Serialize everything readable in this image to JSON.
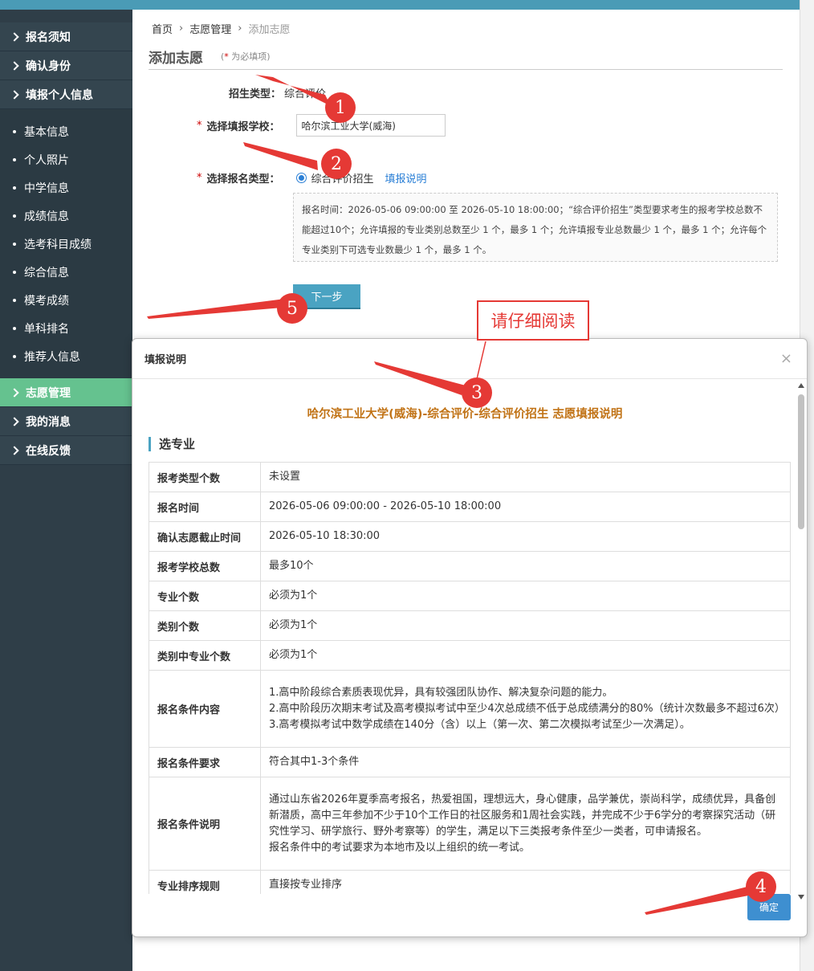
{
  "sidebar": {
    "top_items": [
      {
        "label": "报名须知"
      },
      {
        "label": "确认身份"
      },
      {
        "label": "填报个人信息"
      }
    ],
    "sub_items": [
      {
        "label": "基本信息"
      },
      {
        "label": "个人照片"
      },
      {
        "label": "中学信息"
      },
      {
        "label": "成绩信息"
      },
      {
        "label": "选考科目成绩"
      },
      {
        "label": "综合信息"
      },
      {
        "label": "模考成绩"
      },
      {
        "label": "单科排名"
      },
      {
        "label": "推荐人信息"
      }
    ],
    "bottom_items": [
      {
        "label": "志愿管理",
        "active": true
      },
      {
        "label": "我的消息"
      },
      {
        "label": "在线反馈"
      }
    ]
  },
  "breadcrumb": {
    "home": "首页",
    "section": "志愿管理",
    "current": "添加志愿"
  },
  "page": {
    "title": "添加志愿",
    "required_note_prefix": "(",
    "required_note_star": "*",
    "required_note_text": " 为必填项)"
  },
  "form": {
    "admission_type_label": "招生类型：",
    "admission_type_value": "综合评价",
    "school_label": "选择填报学校：",
    "school_value": "哈尔滨工业大学(威海)",
    "signup_type_label": "选择报名类型：",
    "signup_type_option": "综合评价招生",
    "help_link": "填报说明",
    "info_text": "报名时间：2026-05-06 09:00:00 至 2026-05-10 18:00:00；“综合评价招生”类型要求考生的报考学校总数不能超过10个；允许填报的专业类别总数至少 1 个，最多 1 个；允许填报专业总数最少 1 个，最多 1 个；允许每个专业类别下可选专业数最少 1 个，最多 1 个。",
    "next_button": "下一步"
  },
  "modal": {
    "title": "填报说明",
    "close": "×",
    "heading": "哈尔滨工业大学(威海)-综合评价-综合评价招生 志愿填报说明",
    "section": "选专业",
    "rows": [
      {
        "key": "报考类型个数",
        "value": "未设置"
      },
      {
        "key": "报名时间",
        "value": "2026-05-06 09:00:00 - 2026-05-10 18:00:00"
      },
      {
        "key": "确认志愿截止时间",
        "value": "2026-05-10 18:30:00"
      },
      {
        "key": "报考学校总数",
        "value": "最多10个"
      },
      {
        "key": "专业个数",
        "value": "必须为1个"
      },
      {
        "key": "类别个数",
        "value": "必须为1个"
      },
      {
        "key": "类别中专业个数",
        "value": "必须为1个"
      },
      {
        "key": "报名条件内容",
        "lines": [
          "1.高中阶段综合素质表现优异，具有较强团队协作、解决复杂问题的能力。",
          "2.高中阶段历次期末考试及高考模拟考试中至少4次总成绩不低于总成绩满分的80%（统计次数最多不超过6次）",
          "3.高考模拟考试中数学成绩在140分（含）以上（第一次、第二次模拟考试至少一次满足）。"
        ]
      },
      {
        "key": "报名条件要求",
        "value": "符合其中1-3个条件"
      },
      {
        "key": "报名条件说明",
        "lines": [
          "通过山东省2026年夏季高考报名，热爱祖国，理想远大，身心健康，品学兼优，崇尚科学，成绩优异，具备创新潜质，高中三年参加不少于10个工作日的社区服务和1周社会实践，并完成不少于6学分的考察探究活动（研究性学习、研学旅行、野外考察等）的学生，满足以下三类报考条件至少一类者，可申请报名。",
          "报名条件中的考试要求为本地市及以上组织的统一考试。"
        ]
      },
      {
        "key": "专业排序规则",
        "value": "直接按专业排序"
      }
    ],
    "ok_button": "确定"
  },
  "annotations": {
    "badges": [
      "1",
      "2",
      "3",
      "4",
      "5"
    ],
    "note": "请仔细阅读",
    "color": "#e53935"
  }
}
